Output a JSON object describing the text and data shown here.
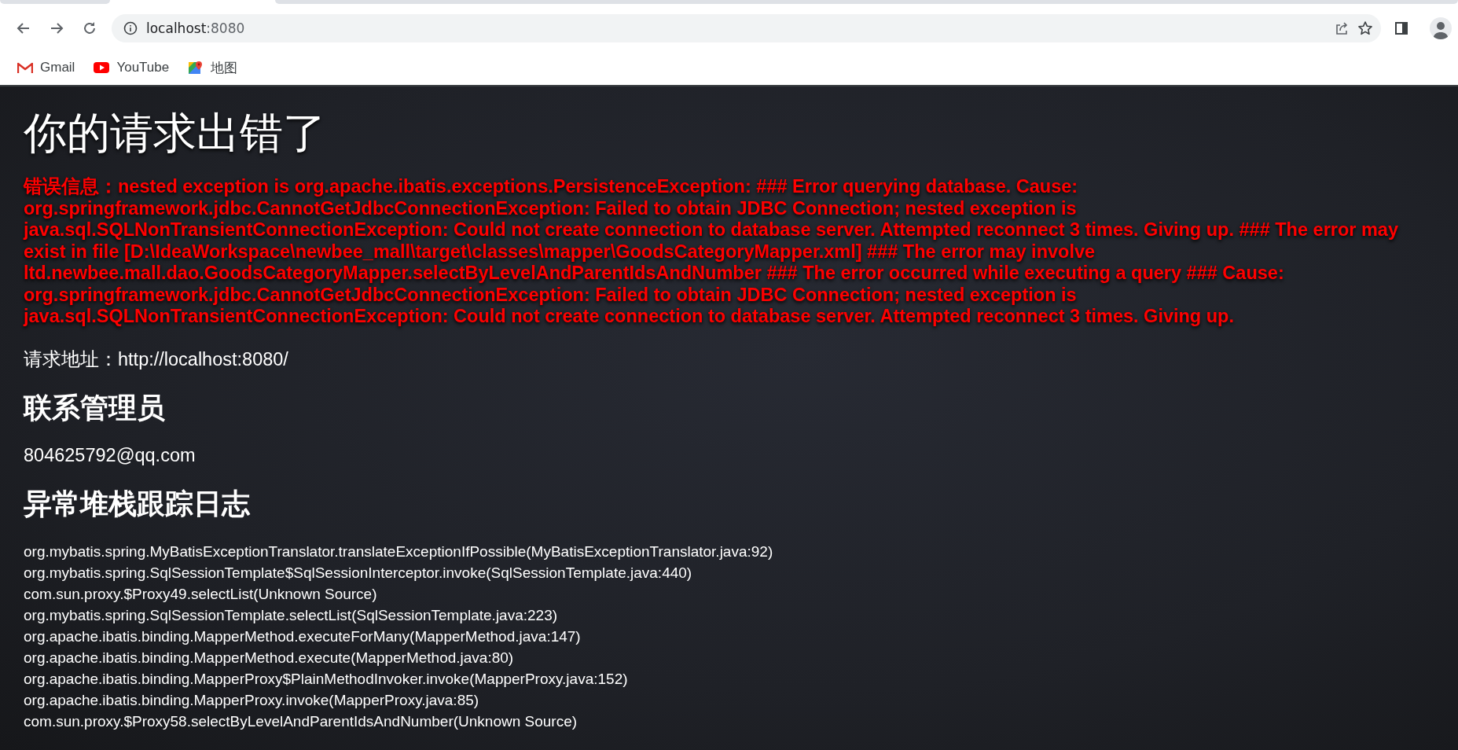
{
  "browser": {
    "address": {
      "host": "localhost",
      "port": ":8080"
    },
    "bookmarks": [
      {
        "kind": "gmail",
        "label": "Gmail"
      },
      {
        "kind": "youtube",
        "label": "YouTube"
      },
      {
        "kind": "maps",
        "label": "地图"
      }
    ]
  },
  "page": {
    "title": "你的请求出错了",
    "error_message": "错误信息：nested exception is org.apache.ibatis.exceptions.PersistenceException: ### Error querying database. Cause: org.springframework.jdbc.CannotGetJdbcConnectionException: Failed to obtain JDBC Connection; nested exception is java.sql.SQLNonTransientConnectionException: Could not create connection to database server. Attempted reconnect 3 times. Giving up. ### The error may exist in file [D:\\IdeaWorkspace\\newbee_mall\\target\\classes\\mapper\\GoodsCategoryMapper.xml] ### The error may involve ltd.newbee.mall.dao.GoodsCategoryMapper.selectByLevelAndParentIdsAndNumber ### The error occurred while executing a query ### Cause: org.springframework.jdbc.CannotGetJdbcConnectionException: Failed to obtain JDBC Connection; nested exception is java.sql.SQLNonTransientConnectionException: Could not create connection to database server. Attempted reconnect 3 times. Giving up.",
    "request_url": "请求地址：http://localhost:8080/",
    "contact_heading": "联系管理员",
    "contact_email": "804625792@qq.com",
    "trace_heading": "异常堆栈跟踪日志",
    "stack_trace": [
      "org.mybatis.spring.MyBatisExceptionTranslator.translateExceptionIfPossible(MyBatisExceptionTranslator.java:92)",
      "org.mybatis.spring.SqlSessionTemplate$SqlSessionInterceptor.invoke(SqlSessionTemplate.java:440)",
      "com.sun.proxy.$Proxy49.selectList(Unknown Source)",
      "org.mybatis.spring.SqlSessionTemplate.selectList(SqlSessionTemplate.java:223)",
      "org.apache.ibatis.binding.MapperMethod.executeForMany(MapperMethod.java:147)",
      "org.apache.ibatis.binding.MapperMethod.execute(MapperMethod.java:80)",
      "org.apache.ibatis.binding.MapperProxy$PlainMethodInvoker.invoke(MapperProxy.java:152)",
      "org.apache.ibatis.binding.MapperProxy.invoke(MapperProxy.java:85)",
      "com.sun.proxy.$Proxy58.selectByLevelAndParentIdsAndNumber(Unknown Source)"
    ]
  }
}
